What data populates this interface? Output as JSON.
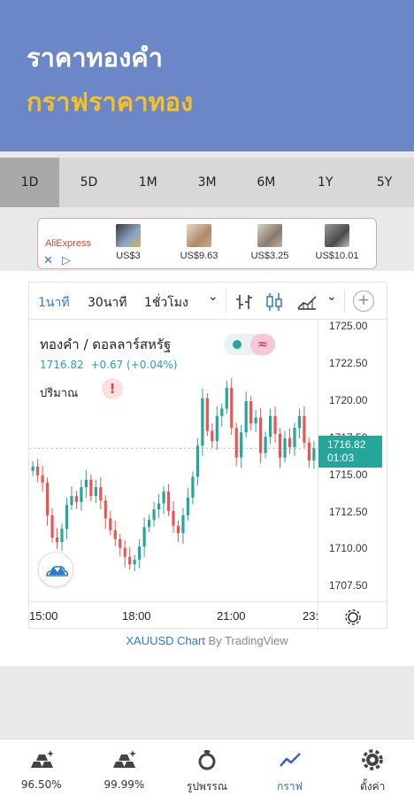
{
  "header": {
    "title": "ราคาทองคำ",
    "subtitle": "กราฟราคาทอง"
  },
  "range_tabs": [
    {
      "label": "1D",
      "active": true
    },
    {
      "label": "5D",
      "active": false
    },
    {
      "label": "1M",
      "active": false
    },
    {
      "label": "3M",
      "active": false
    },
    {
      "label": "6M",
      "active": false
    },
    {
      "label": "1Y",
      "active": false
    },
    {
      "label": "5Y",
      "active": false
    }
  ],
  "ad": {
    "brand": "AliExpress",
    "close_symbol": "✕",
    "choices_symbol": "▷",
    "items": [
      {
        "price": "US$3"
      },
      {
        "price": "US$9.63"
      },
      {
        "price": "US$3.25"
      },
      {
        "price": "US$10.01"
      }
    ]
  },
  "chart_toolbar": {
    "intervals": [
      "1นาที",
      "30นาที",
      "1ชั่วโมง"
    ],
    "active_interval": "1นาที",
    "dropdown_symbol": "⌄",
    "add_symbol": "+"
  },
  "chart_legend": {
    "symbol": "ทองคำ / ดอลลาร์สหรัฐ",
    "price": "1716.82",
    "change": "+0.67 (+0.04%)",
    "volume_label": "ปริมาณ",
    "volume_warning": "!",
    "wave_symbol": "≈"
  },
  "chart_data": {
    "type": "candlestick",
    "x_ticks": [
      "15:00",
      "18:00",
      "21:00",
      "23:"
    ],
    "y_ticks": [
      "1725.00",
      "1722.50",
      "1720.00",
      "1717.50",
      "1715.00",
      "1712.50",
      "1710.00",
      "1707.50"
    ],
    "ylim": [
      1706.5,
      1725.5
    ],
    "current_price": "1716.82",
    "countdown": "01:03",
    "ohlc_close": [
      1715.6,
      1715.0,
      1714.5,
      1712.3,
      1710.8,
      1710.5,
      1711.4,
      1713.0,
      1713.6,
      1713.2,
      1714.2,
      1714.7,
      1713.6,
      1714.2,
      1713.3,
      1712.1,
      1711.3,
      1710.7,
      1710.1,
      1709.5,
      1709.0,
      1709.3,
      1710.2,
      1711.5,
      1712.0,
      1712.7,
      1713.1,
      1713.9,
      1712.6,
      1711.6,
      1711.1,
      1712.3,
      1713.5,
      1714.9,
      1717.0,
      1720.2,
      1718.0,
      1717.3,
      1719.0,
      1719.5,
      1720.9,
      1718.2,
      1716.2,
      1717.9,
      1720.0,
      1718.5,
      1718.9,
      1716.5,
      1717.6,
      1719.0,
      1717.8,
      1716.2,
      1717.5,
      1716.9,
      1718.2,
      1719.0,
      1717.2,
      1716.0,
      1716.82
    ],
    "up_color": "#26a69a",
    "down_color": "#ef5350"
  },
  "credit": {
    "link": "XAUUSD Chart",
    "by": " By TradingView"
  },
  "bottom_nav": [
    {
      "label": "96.50%",
      "icon": "gold-bars-sparkle-icon",
      "active": false
    },
    {
      "label": "99.99%",
      "icon": "gold-bars-sparkle-icon",
      "active": false
    },
    {
      "label": "รูปพรรณ",
      "icon": "ring-icon",
      "active": false
    },
    {
      "label": "กราฟ",
      "icon": "trend-line-icon",
      "active": true
    },
    {
      "label": "ตั้งค่า",
      "icon": "gear-icon",
      "active": false
    }
  ]
}
